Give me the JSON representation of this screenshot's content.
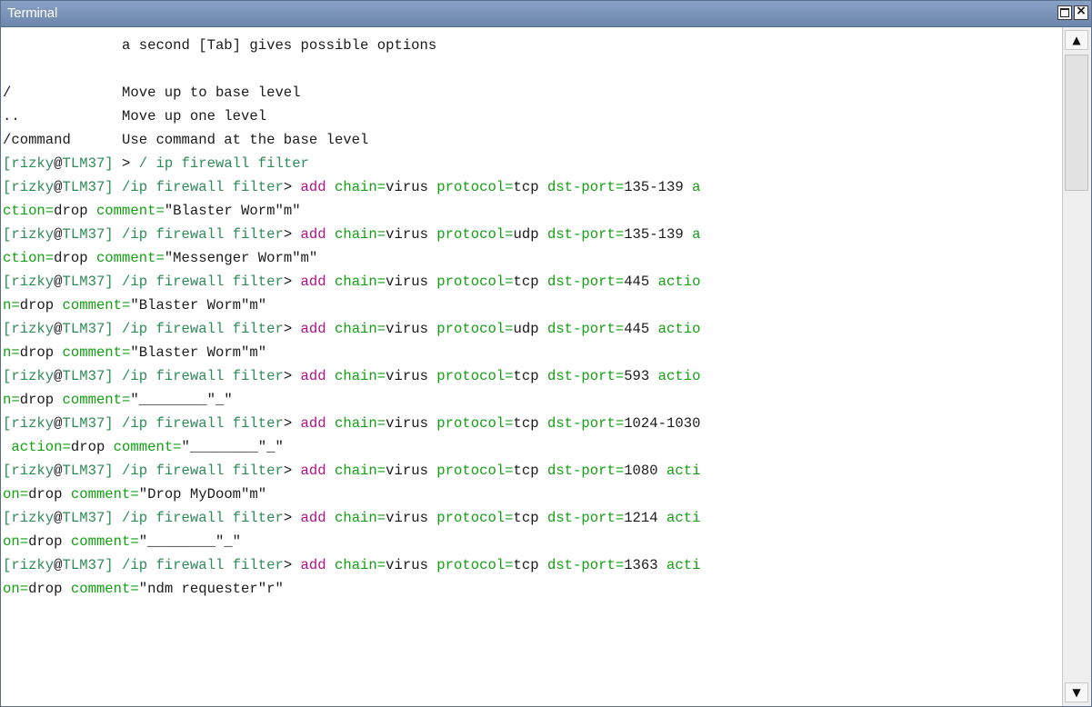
{
  "window": {
    "title": "Terminal",
    "maximize_icon": "maximize-icon",
    "close_icon": "close-icon",
    "close_glyph": "×"
  },
  "scrollbar": {
    "up_glyph": "▲",
    "down_glyph": "▼"
  },
  "colors": {
    "title_bar": "#7b93b9",
    "prompt": "#2e8b57",
    "keyword": "#13a013",
    "command": "#b0108a",
    "text": "#1a1a1a"
  },
  "terminal": {
    "lines": [
      [
        {
          "t": "              a second [Tab] gives possible options",
          "c": "plain"
        }
      ],
      [
        {
          "t": "",
          "c": "plain"
        }
      ],
      [
        {
          "t": "/             Move up to base level",
          "c": "plain"
        }
      ],
      [
        {
          "t": "..            Move up one level",
          "c": "plain"
        }
      ],
      [
        {
          "t": "/command      Use command at the base level",
          "c": "plain"
        }
      ],
      [
        {
          "t": "[rizky",
          "c": "prompt"
        },
        {
          "t": "@",
          "c": "at"
        },
        {
          "t": "TLM37] ",
          "c": "prompt"
        },
        {
          "t": ">",
          "c": "plain"
        },
        {
          "t": " / ip firewall filter",
          "c": "prompt"
        }
      ],
      [
        {
          "t": "[rizky",
          "c": "prompt"
        },
        {
          "t": "@",
          "c": "at"
        },
        {
          "t": "TLM37] /ip firewall filter",
          "c": "prompt"
        },
        {
          "t": "> ",
          "c": "plain"
        },
        {
          "t": "add ",
          "c": "cmd"
        },
        {
          "t": "chain=",
          "c": "key"
        },
        {
          "t": "virus ",
          "c": "plain"
        },
        {
          "t": "protocol=",
          "c": "key"
        },
        {
          "t": "tcp ",
          "c": "plain"
        },
        {
          "t": "dst-port=",
          "c": "key"
        },
        {
          "t": "135-139 ",
          "c": "plain"
        },
        {
          "t": "a",
          "c": "key"
        }
      ],
      [
        {
          "t": "ction=",
          "c": "key"
        },
        {
          "t": "drop ",
          "c": "plain"
        },
        {
          "t": "comment=",
          "c": "key"
        },
        {
          "t": "\"Blaster Worm\"m\"",
          "c": "plain"
        }
      ],
      [
        {
          "t": "[rizky",
          "c": "prompt"
        },
        {
          "t": "@",
          "c": "at"
        },
        {
          "t": "TLM37] /ip firewall filter",
          "c": "prompt"
        },
        {
          "t": "> ",
          "c": "plain"
        },
        {
          "t": "add ",
          "c": "cmd"
        },
        {
          "t": "chain=",
          "c": "key"
        },
        {
          "t": "virus ",
          "c": "plain"
        },
        {
          "t": "protocol=",
          "c": "key"
        },
        {
          "t": "udp ",
          "c": "plain"
        },
        {
          "t": "dst-port=",
          "c": "key"
        },
        {
          "t": "135-139 ",
          "c": "plain"
        },
        {
          "t": "a",
          "c": "key"
        }
      ],
      [
        {
          "t": "ction=",
          "c": "key"
        },
        {
          "t": "drop ",
          "c": "plain"
        },
        {
          "t": "comment=",
          "c": "key"
        },
        {
          "t": "\"Messenger Worm\"m\"",
          "c": "plain"
        }
      ],
      [
        {
          "t": "[rizky",
          "c": "prompt"
        },
        {
          "t": "@",
          "c": "at"
        },
        {
          "t": "TLM37] /ip firewall filter",
          "c": "prompt"
        },
        {
          "t": "> ",
          "c": "plain"
        },
        {
          "t": "add ",
          "c": "cmd"
        },
        {
          "t": "chain=",
          "c": "key"
        },
        {
          "t": "virus ",
          "c": "plain"
        },
        {
          "t": "protocol=",
          "c": "key"
        },
        {
          "t": "tcp ",
          "c": "plain"
        },
        {
          "t": "dst-port=",
          "c": "key"
        },
        {
          "t": "445 ",
          "c": "plain"
        },
        {
          "t": "actio",
          "c": "key"
        }
      ],
      [
        {
          "t": "n=",
          "c": "key"
        },
        {
          "t": "drop ",
          "c": "plain"
        },
        {
          "t": "comment=",
          "c": "key"
        },
        {
          "t": "\"Blaster Worm\"m\"",
          "c": "plain"
        }
      ],
      [
        {
          "t": "[rizky",
          "c": "prompt"
        },
        {
          "t": "@",
          "c": "at"
        },
        {
          "t": "TLM37] /ip firewall filter",
          "c": "prompt"
        },
        {
          "t": "> ",
          "c": "plain"
        },
        {
          "t": "add ",
          "c": "cmd"
        },
        {
          "t": "chain=",
          "c": "key"
        },
        {
          "t": "virus ",
          "c": "plain"
        },
        {
          "t": "protocol=",
          "c": "key"
        },
        {
          "t": "udp ",
          "c": "plain"
        },
        {
          "t": "dst-port=",
          "c": "key"
        },
        {
          "t": "445 ",
          "c": "plain"
        },
        {
          "t": "actio",
          "c": "key"
        }
      ],
      [
        {
          "t": "n=",
          "c": "key"
        },
        {
          "t": "drop ",
          "c": "plain"
        },
        {
          "t": "comment=",
          "c": "key"
        },
        {
          "t": "\"Blaster Worm\"m\"",
          "c": "plain"
        }
      ],
      [
        {
          "t": "[rizky",
          "c": "prompt"
        },
        {
          "t": "@",
          "c": "at"
        },
        {
          "t": "TLM37] /ip firewall filter",
          "c": "prompt"
        },
        {
          "t": "> ",
          "c": "plain"
        },
        {
          "t": "add ",
          "c": "cmd"
        },
        {
          "t": "chain=",
          "c": "key"
        },
        {
          "t": "virus ",
          "c": "plain"
        },
        {
          "t": "protocol=",
          "c": "key"
        },
        {
          "t": "tcp ",
          "c": "plain"
        },
        {
          "t": "dst-port=",
          "c": "key"
        },
        {
          "t": "593 ",
          "c": "plain"
        },
        {
          "t": "actio",
          "c": "key"
        }
      ],
      [
        {
          "t": "n=",
          "c": "key"
        },
        {
          "t": "drop ",
          "c": "plain"
        },
        {
          "t": "comment=",
          "c": "key"
        },
        {
          "t": "\"________\"_\"",
          "c": "plain"
        }
      ],
      [
        {
          "t": "[rizky",
          "c": "prompt"
        },
        {
          "t": "@",
          "c": "at"
        },
        {
          "t": "TLM37] /ip firewall filter",
          "c": "prompt"
        },
        {
          "t": "> ",
          "c": "plain"
        },
        {
          "t": "add ",
          "c": "cmd"
        },
        {
          "t": "chain=",
          "c": "key"
        },
        {
          "t": "virus ",
          "c": "plain"
        },
        {
          "t": "protocol=",
          "c": "key"
        },
        {
          "t": "tcp ",
          "c": "plain"
        },
        {
          "t": "dst-port=",
          "c": "key"
        },
        {
          "t": "1024-1030",
          "c": "plain"
        }
      ],
      [
        {
          "t": " action=",
          "c": "key"
        },
        {
          "t": "drop ",
          "c": "plain"
        },
        {
          "t": "comment=",
          "c": "key"
        },
        {
          "t": "\"________\"_\"",
          "c": "plain"
        }
      ],
      [
        {
          "t": "[rizky",
          "c": "prompt"
        },
        {
          "t": "@",
          "c": "at"
        },
        {
          "t": "TLM37] /ip firewall filter",
          "c": "prompt"
        },
        {
          "t": "> ",
          "c": "plain"
        },
        {
          "t": "add ",
          "c": "cmd"
        },
        {
          "t": "chain=",
          "c": "key"
        },
        {
          "t": "virus ",
          "c": "plain"
        },
        {
          "t": "protocol=",
          "c": "key"
        },
        {
          "t": "tcp ",
          "c": "plain"
        },
        {
          "t": "dst-port=",
          "c": "key"
        },
        {
          "t": "1080 ",
          "c": "plain"
        },
        {
          "t": "acti",
          "c": "key"
        }
      ],
      [
        {
          "t": "on=",
          "c": "key"
        },
        {
          "t": "drop ",
          "c": "plain"
        },
        {
          "t": "comment=",
          "c": "key"
        },
        {
          "t": "\"Drop MyDoom\"m\"",
          "c": "plain"
        }
      ],
      [
        {
          "t": "[rizky",
          "c": "prompt"
        },
        {
          "t": "@",
          "c": "at"
        },
        {
          "t": "TLM37] /ip firewall filter",
          "c": "prompt"
        },
        {
          "t": "> ",
          "c": "plain"
        },
        {
          "t": "add ",
          "c": "cmd"
        },
        {
          "t": "chain=",
          "c": "key"
        },
        {
          "t": "virus ",
          "c": "plain"
        },
        {
          "t": "protocol=",
          "c": "key"
        },
        {
          "t": "tcp ",
          "c": "plain"
        },
        {
          "t": "dst-port=",
          "c": "key"
        },
        {
          "t": "1214 ",
          "c": "plain"
        },
        {
          "t": "acti",
          "c": "key"
        }
      ],
      [
        {
          "t": "on=",
          "c": "key"
        },
        {
          "t": "drop ",
          "c": "plain"
        },
        {
          "t": "comment=",
          "c": "key"
        },
        {
          "t": "\"________\"_\"",
          "c": "plain"
        }
      ],
      [
        {
          "t": "[rizky",
          "c": "prompt"
        },
        {
          "t": "@",
          "c": "at"
        },
        {
          "t": "TLM37] /ip firewall filter",
          "c": "prompt"
        },
        {
          "t": "> ",
          "c": "plain"
        },
        {
          "t": "add ",
          "c": "cmd"
        },
        {
          "t": "chain=",
          "c": "key"
        },
        {
          "t": "virus ",
          "c": "plain"
        },
        {
          "t": "protocol=",
          "c": "key"
        },
        {
          "t": "tcp ",
          "c": "plain"
        },
        {
          "t": "dst-port=",
          "c": "key"
        },
        {
          "t": "1363 ",
          "c": "plain"
        },
        {
          "t": "acti",
          "c": "key"
        }
      ],
      [
        {
          "t": "on=",
          "c": "key"
        },
        {
          "t": "drop ",
          "c": "plain"
        },
        {
          "t": "comment=",
          "c": "key"
        },
        {
          "t": "\"ndm requester\"r\"",
          "c": "plain"
        }
      ]
    ]
  }
}
